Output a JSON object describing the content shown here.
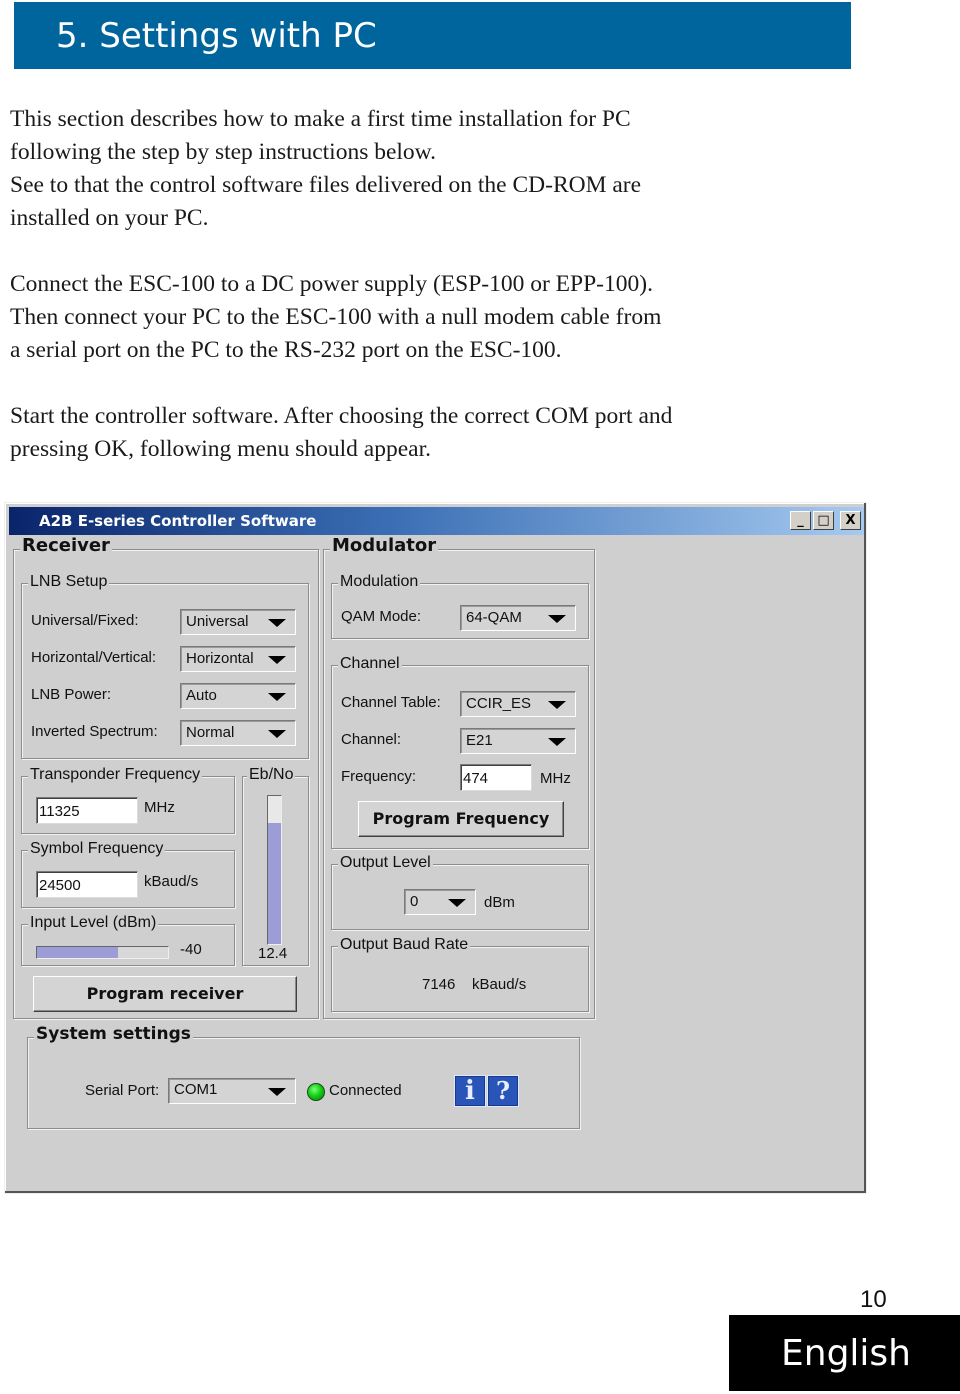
{
  "section": {
    "title": "5. Settings with PC",
    "header_color": "#00659c"
  },
  "paragraphs": [
    {
      "lines": [
        "This section describes how to make a first time installation for PC",
        "following the step by step instructions below.",
        "See to that the control software files delivered on the CD-ROM are",
        "installed on your PC."
      ]
    },
    {
      "lines": [
        "Connect the ESC-100 to a DC power supply (ESP-100 or EPP-100).",
        "Then connect your PC to the ESC-100 with a null modem cable from",
        "a serial port on the PC to the RS-232 port on the ESC-100."
      ]
    },
    {
      "lines": [
        "Start the controller software. After choosing the correct COM port and",
        "pressing OK, following menu should appear."
      ]
    }
  ],
  "window": {
    "title": "A2B E-series Controller Software",
    "controls": {
      "minimize": "_",
      "maximize": "□",
      "close": "X"
    },
    "receiver": {
      "title": "Receiver",
      "lnb_setup": {
        "title": "LNB Setup",
        "rows": [
          {
            "label": "Universal/Fixed:",
            "value": "Universal"
          },
          {
            "label": "Horizontal/Vertical:",
            "value": "Horizontal"
          },
          {
            "label": "LNB Power:",
            "value": "Auto"
          },
          {
            "label": "Inverted Spectrum:",
            "value": "Normal"
          }
        ]
      },
      "transponder_frequency": {
        "title": "Transponder Frequency",
        "value": "11325",
        "unit": "MHz"
      },
      "symbol_frequency": {
        "title": "Symbol Frequency",
        "value": "24500",
        "unit": "kBaud/s"
      },
      "input_level": {
        "title": "Input Level (dBm)",
        "value": "-40",
        "fill_fraction": 0.62
      },
      "ebno": {
        "title": "Eb/No",
        "value": "12.4",
        "fill_fraction": 0.82
      },
      "program_button": "Program receiver"
    },
    "modulator": {
      "title": "Modulator",
      "modulation": {
        "title": "Modulation",
        "label": "QAM Mode:",
        "value": "64-QAM"
      },
      "channel": {
        "title": "Channel",
        "table_label": "Channel Table:",
        "table_value": "CCIR_ES",
        "channel_label": "Channel:",
        "channel_value": "E21",
        "frequency_label": "Frequency:",
        "frequency_value": "474",
        "frequency_unit": "MHz"
      },
      "program_button": "Program Frequency",
      "output_level": {
        "title": "Output Level",
        "value": "0",
        "unit": "dBm"
      },
      "output_baud_rate": {
        "title": "Output Baud Rate",
        "value": "7146",
        "unit": "kBaud/s"
      }
    },
    "system_settings": {
      "title": "System settings",
      "serial_port_label": "Serial Port:",
      "serial_port_value": "COM1",
      "status": "Connected",
      "status_color": "#15d015",
      "info_icon": "i",
      "help_icon": "?"
    }
  },
  "footer": {
    "page_number": "10",
    "language": "English"
  }
}
